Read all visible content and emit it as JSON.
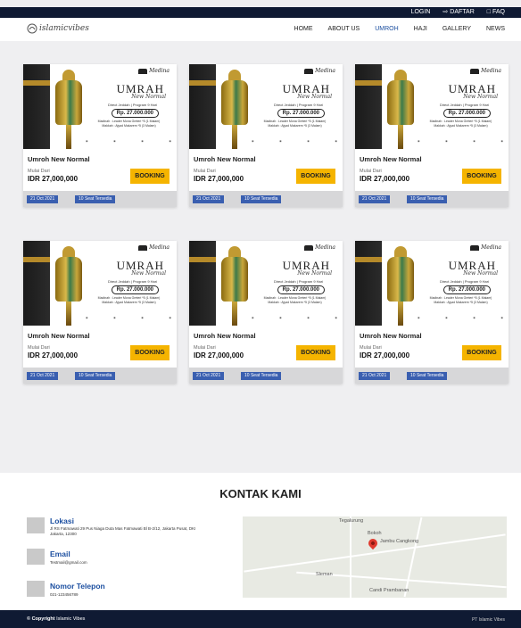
{
  "topbar": {
    "login": "LOGIN",
    "daftar": "DAFTAR",
    "faq": "FAQ"
  },
  "brand": {
    "logo_text": "islamicvibes"
  },
  "nav": [
    "HOME",
    "ABOUT US",
    "UMROH",
    "HAJI",
    "GALLERY",
    "NEWS"
  ],
  "nav_active": "UMROH",
  "colors": {
    "nav_dark": "#0f1a33",
    "accent_blue": "#1c4fa0",
    "booking_yellow": "#f5b400",
    "tag_blue": "#3a5fb0"
  },
  "package_image": {
    "brand": "Medina",
    "title": "UMRAH",
    "script": "New Normal",
    "subtitle": "Direct Jeddah | Program 9 Hari",
    "price": "Rp. 27.000.000",
    "fine_1": "Madinah : Leader Mona Greteri *5 (1 Malam)",
    "fine_2": "Makkah : Ajyad Makarem *5 (3 Malam)"
  },
  "cards": [
    {
      "title": "Umroh New Normal",
      "from_label": "Mulai Dari",
      "price": "IDR 27,000,000",
      "button": "BOOKING",
      "date": "21 Oct 2021",
      "seats": "10 Seat Tersedia"
    },
    {
      "title": "Umroh New Normal",
      "from_label": "Mulai Dari",
      "price": "IDR 27,000,000",
      "button": "BOOKING",
      "date": "21 Oct 2021",
      "seats": "10 Seat Tersedia"
    },
    {
      "title": "Umroh New Normal",
      "from_label": "Mulai Dari",
      "price": "IDR 27,000,000",
      "button": "BOOKING",
      "date": "21 Oct 2021",
      "seats": "10 Seat Tersedia"
    },
    {
      "title": "Umroh New Normal",
      "from_label": "Mulai Dari",
      "price": "IDR 27,000,000",
      "button": "BOOKING",
      "date": "21 Oct 2021",
      "seats": "10 Seat Tersedia"
    },
    {
      "title": "Umroh New Normal",
      "from_label": "Mulai Dari",
      "price": "IDR 27,000,000",
      "button": "BOOKING",
      "date": "21 Oct 2021",
      "seats": "10 Seat Tersedia"
    },
    {
      "title": "Umroh New Normal",
      "from_label": "Mulai Dari",
      "price": "IDR 27,000,000",
      "button": "BOOKING",
      "date": "21 Oct 2021",
      "seats": "10 Seat Tersedia"
    }
  ],
  "kontak": {
    "title": "KONTAK KAMI",
    "lokasi_label": "Lokasi",
    "lokasi_value": "Jl RS Fatmawati 29 Pus Niaga Duta Mas Fatmawati Bl B-2/12, Jakarta Pusat, DKI Jakarta, 12300",
    "email_label": "Email",
    "email_value": "Testmail@gmail.com",
    "phone_label": "Nomor Telepon",
    "phone_value": "021-123456789"
  },
  "map": {
    "label_1": "Tegalurung",
    "label_2": "Bokoh",
    "label_3": "Jambu Cangkong",
    "label_4": "Sleman",
    "label_5": "Candi Prambanan"
  },
  "footer": {
    "copyright_label": "© Copyright",
    "copyright_name": "Islamic Vibes",
    "company": "PT Islamic Vibes"
  }
}
